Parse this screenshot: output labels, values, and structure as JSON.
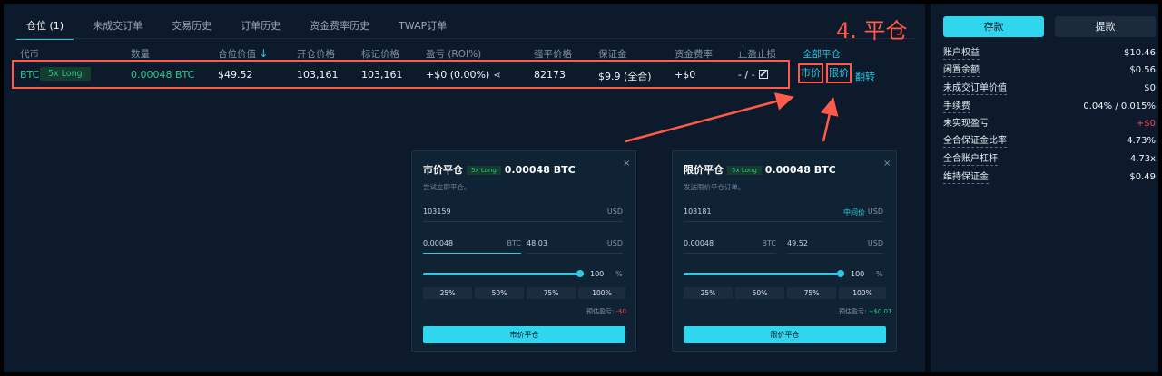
{
  "annotation": {
    "step_label": "4. 平仓"
  },
  "tabs": [
    {
      "label": "仓位 (1)"
    },
    {
      "label": "未成交订单"
    },
    {
      "label": "交易历史"
    },
    {
      "label": "订单历史"
    },
    {
      "label": "资金费率历史"
    },
    {
      "label": "TWAP订单"
    }
  ],
  "table": {
    "headers": {
      "coin": "代币",
      "size": "数量",
      "position_value": "合位价值",
      "entry_price": "开仓价格",
      "mark_price": "标记价格",
      "pnl": "盈亏 (ROI%)",
      "liq_price": "强平价格",
      "margin": "保证金",
      "funding": "资金费率",
      "tpsl": "止盈止损",
      "close_all": "全部平仓"
    },
    "row": {
      "coin": "BTC",
      "leverage": "5x Long",
      "size": "0.00048 BTC",
      "position_value": "$49.52",
      "entry_price": "103,161",
      "mark_price": "103,161",
      "pnl": "+$0 (0.00%)",
      "liq_price": "82173",
      "margin": "$9.9 (全合)",
      "funding": "+$0",
      "tpsl": "- / -",
      "market_btn": "市价",
      "limit_btn": "限价",
      "flip_btn": "翻转"
    }
  },
  "market_dialog": {
    "title": "市价平仓",
    "leverage": "5x Long",
    "amount": "0.00048 BTC",
    "close": "×",
    "description": "尝试立即平仓。",
    "price": "103159",
    "price_unit": "USD",
    "qty": "0.00048",
    "qty_unit": "BTC",
    "usd_value": "48.03",
    "usd_unit": "USD",
    "slider_pct": 100,
    "slider_label": "100",
    "pct_sign": "%",
    "quick": [
      "25%",
      "50%",
      "75%",
      "100%"
    ],
    "est_label": "预估盈亏:",
    "est_value": "-$0",
    "submit": "市价平仓"
  },
  "limit_dialog": {
    "title": "限价平仓",
    "leverage": "5x Long",
    "amount": "0.00048 BTC",
    "close": "×",
    "description": "发送限价平仓订单。",
    "price": "103181",
    "mid_label": "中间价",
    "price_unit": "USD",
    "qty": "0.00048",
    "qty_unit": "BTC",
    "usd_value": "49.52",
    "usd_unit": "USD",
    "slider_pct": 100,
    "slider_label": "100",
    "pct_sign": "%",
    "quick": [
      "25%",
      "50%",
      "75%",
      "100%"
    ],
    "est_label": "预估盈亏:",
    "est_value": "+$0.01",
    "submit": "限价平仓"
  },
  "sidebar": {
    "deposit": "存款",
    "withdraw": "提款",
    "items": [
      {
        "label": "账户权益",
        "value": "$10.46"
      },
      {
        "label": "闲置余额",
        "value": "$0.56"
      },
      {
        "label": "未成交订单价值",
        "value": "$0"
      },
      {
        "label": "手续费",
        "value": "0.04% / 0.015%"
      },
      {
        "label": "未实现盈亏",
        "value": "+$0"
      },
      {
        "label": "全合保证金比率",
        "value": "4.73%"
      },
      {
        "label": "全合账户杠杆",
        "value": "4.73x"
      },
      {
        "label": "维持保证金",
        "value": "$0.49"
      }
    ]
  },
  "colors": {
    "accent": "#30c8e2",
    "long": "#25d08a",
    "negative": "#f04a5a",
    "annotation": "#ff5a4a"
  }
}
